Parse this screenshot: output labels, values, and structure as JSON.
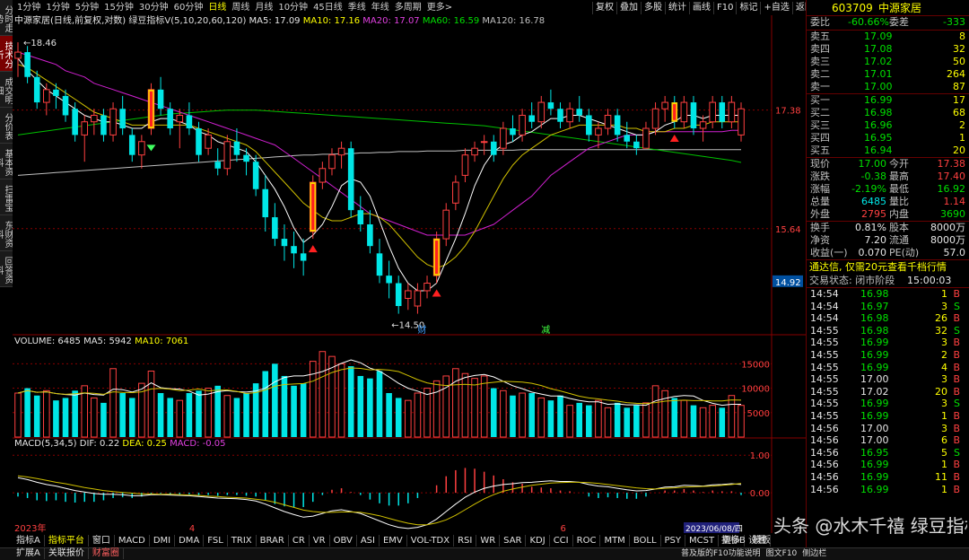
{
  "side_tabs": [
    "分时走势",
    "技术分析",
    "成交明细",
    "分价表",
    "基本资料",
    "扫雷宝",
    "东财资料",
    "回答资料"
  ],
  "period_tabs": [
    "1分钟",
    "1分钟",
    "5分钟",
    "15分钟",
    "30分钟",
    "60分钟",
    "日线",
    "周线",
    "月线",
    "10分钟",
    "45日线",
    "季线",
    "年线",
    "多周期",
    "更多>"
  ],
  "period_active": 6,
  "top_right_buttons": [
    "复权",
    "叠加",
    "多股",
    "统计",
    "画线",
    "F10",
    "标记",
    "+自选",
    "返回"
  ],
  "main": {
    "title": "中源家居(日线,前复权,对数)",
    "indicator": "绿豆指标V(5,10,20,60,120)",
    "ma5": "MA5: 17.09",
    "ma10": "MA10: 17.16",
    "ma20": "MA20: 17.07",
    "ma60": "MA60: 16.59",
    "ma120": "MA120: 16.78",
    "high_label": "18.46",
    "low_label": "14.50",
    "y_ticks": [
      "17.38",
      "15.64"
    ],
    "price_tag": "14.92",
    "event_labels": [
      "财",
      "减"
    ]
  },
  "volume": {
    "label": "VOLUME: 6485",
    "ma5": "MA5: 5942",
    "ma10": "MA10: 7061",
    "y_ticks": [
      "15000",
      "10000",
      "5000"
    ]
  },
  "macd": {
    "label": "MACD(5,34,5)",
    "dif": "DIF: 0.22",
    "dea": "DEA: 0.25",
    "macd": "MACD: -0.05",
    "y_ticks": [
      "1.00",
      "0.00"
    ]
  },
  "x_labels": [
    "2023年",
    "4",
    "6",
    "2023/06/08/四"
  ],
  "chart_data": {
    "type": "candlestick",
    "ylim": [
      14.3,
      18.7
    ],
    "candles": [
      [
        18.2,
        18.46,
        17.9,
        18.3
      ],
      [
        18.3,
        18.4,
        17.8,
        17.9
      ],
      [
        17.9,
        18.0,
        17.4,
        17.5
      ],
      [
        17.5,
        17.8,
        17.3,
        17.7
      ],
      [
        17.7,
        17.8,
        17.4,
        17.6
      ],
      [
        17.6,
        17.7,
        17.2,
        17.3
      ],
      [
        17.4,
        17.5,
        16.9,
        17.0
      ],
      [
        17.0,
        17.3,
        16.6,
        17.2
      ],
      [
        17.2,
        17.4,
        17.0,
        17.3
      ],
      [
        17.3,
        17.4,
        16.9,
        17.0
      ],
      [
        17.0,
        17.5,
        16.9,
        17.4
      ],
      [
        17.4,
        17.6,
        17.0,
        17.1
      ],
      [
        17.0,
        17.1,
        16.6,
        16.7
      ],
      [
        16.7,
        17.0,
        16.5,
        16.9
      ],
      [
        17.1,
        17.8,
        17.0,
        17.7
      ],
      [
        17.7,
        17.9,
        17.3,
        17.4
      ],
      [
        17.4,
        17.5,
        17.0,
        17.1
      ],
      [
        17.2,
        17.4,
        16.8,
        17.3
      ],
      [
        17.3,
        17.5,
        17.0,
        17.1
      ],
      [
        17.1,
        17.2,
        16.6,
        16.7
      ],
      [
        16.8,
        17.1,
        16.7,
        17.0
      ],
      [
        16.6,
        16.8,
        16.4,
        16.5
      ],
      [
        16.5,
        17.0,
        16.4,
        16.9
      ],
      [
        16.9,
        17.1,
        16.6,
        16.7
      ],
      [
        16.7,
        16.8,
        16.4,
        16.6
      ],
      [
        16.6,
        16.7,
        16.1,
        16.2
      ],
      [
        16.2,
        16.4,
        15.6,
        15.8
      ],
      [
        15.8,
        16.0,
        15.4,
        15.5
      ],
      [
        15.5,
        15.7,
        15.2,
        15.4
      ],
      [
        15.4,
        15.6,
        15.1,
        15.3
      ],
      [
        15.3,
        15.5,
        15.0,
        15.2
      ],
      [
        15.6,
        16.4,
        15.5,
        16.3
      ],
      [
        16.3,
        16.6,
        16.2,
        16.5
      ],
      [
        16.5,
        16.8,
        16.4,
        16.7
      ],
      [
        16.7,
        16.9,
        16.5,
        16.8
      ],
      [
        16.8,
        16.9,
        15.8,
        15.9
      ],
      [
        15.9,
        16.1,
        15.6,
        15.7
      ],
      [
        15.7,
        15.9,
        15.3,
        15.4
      ],
      [
        15.3,
        15.5,
        14.9,
        15.0
      ],
      [
        15.0,
        15.2,
        14.7,
        14.9
      ],
      [
        14.9,
        15.0,
        14.5,
        14.6
      ],
      [
        14.7,
        14.9,
        14.55,
        14.8
      ],
      [
        14.6,
        14.9,
        14.5,
        14.8
      ],
      [
        14.8,
        15.0,
        14.7,
        14.9
      ],
      [
        15.0,
        15.6,
        14.9,
        15.5
      ],
      [
        15.5,
        16.0,
        15.4,
        15.9
      ],
      [
        16.0,
        16.4,
        15.9,
        16.3
      ],
      [
        16.4,
        16.8,
        16.3,
        16.7
      ],
      [
        16.7,
        16.9,
        16.6,
        16.8
      ],
      [
        16.9,
        17.0,
        16.7,
        16.9
      ],
      [
        16.9,
        17.0,
        16.6,
        16.7
      ],
      [
        16.8,
        17.2,
        16.7,
        17.1
      ],
      [
        17.1,
        17.3,
        16.9,
        17.0
      ],
      [
        17.0,
        17.4,
        16.9,
        17.3
      ],
      [
        17.3,
        17.5,
        17.1,
        17.2
      ],
      [
        17.2,
        17.6,
        17.1,
        17.5
      ],
      [
        17.5,
        17.7,
        17.3,
        17.4
      ],
      [
        17.4,
        17.5,
        17.1,
        17.2
      ],
      [
        17.2,
        17.5,
        17.1,
        17.4
      ],
      [
        17.4,
        17.6,
        17.2,
        17.3
      ],
      [
        17.3,
        17.4,
        16.9,
        17.0
      ],
      [
        17.0,
        17.2,
        16.8,
        17.1
      ],
      [
        17.1,
        17.4,
        17.0,
        17.3
      ],
      [
        17.3,
        17.4,
        16.9,
        17.0
      ],
      [
        17.0,
        17.2,
        16.8,
        16.9
      ],
      [
        16.9,
        17.0,
        16.7,
        16.8
      ],
      [
        16.8,
        17.2,
        16.8,
        17.1
      ],
      [
        17.1,
        17.5,
        17.0,
        17.4
      ],
      [
        17.4,
        17.6,
        17.2,
        17.5
      ],
      [
        17.5,
        17.6,
        17.1,
        17.2
      ],
      [
        17.2,
        17.6,
        17.1,
        17.5
      ],
      [
        17.5,
        17.6,
        17.0,
        17.1
      ],
      [
        17.1,
        17.3,
        16.9,
        17.2
      ],
      [
        17.2,
        17.6,
        17.1,
        17.5
      ],
      [
        17.5,
        17.6,
        17.1,
        17.2
      ],
      [
        17.2,
        17.6,
        17.1,
        17.5
      ],
      [
        17.0,
        17.5,
        16.9,
        17.4
      ]
    ],
    "ma5": [
      18.2,
      18.0,
      17.85,
      17.7,
      17.6,
      17.5,
      17.4,
      17.3,
      17.25,
      17.2,
      17.2,
      17.15,
      17.1,
      17.1,
      17.2,
      17.25,
      17.25,
      17.2,
      17.15,
      17.05,
      17.0,
      16.9,
      16.85,
      16.8,
      16.75,
      16.6,
      16.4,
      16.2,
      15.95,
      15.65,
      15.45,
      15.55,
      15.7,
      15.95,
      16.25,
      16.35,
      16.3,
      16.1,
      15.75,
      15.4,
      15.1,
      14.9,
      14.8,
      14.8,
      14.9,
      15.2,
      15.5,
      15.85,
      16.25,
      16.55,
      16.75,
      16.85,
      16.9,
      17.0,
      17.05,
      17.15,
      17.25,
      17.25,
      17.3,
      17.3,
      17.25,
      17.2,
      17.15,
      17.1,
      17.05,
      17.0,
      17.0,
      17.05,
      17.15,
      17.2,
      17.3,
      17.3,
      17.25,
      17.3,
      17.3,
      17.3,
      17.3
    ],
    "ma10": [
      18.1,
      18.05,
      17.95,
      17.85,
      17.75,
      17.65,
      17.55,
      17.45,
      17.35,
      17.3,
      17.25,
      17.2,
      17.15,
      17.15,
      17.15,
      17.15,
      17.15,
      17.15,
      17.15,
      17.1,
      17.05,
      17.0,
      16.95,
      16.9,
      16.85,
      16.75,
      16.6,
      16.45,
      16.3,
      16.15,
      16.0,
      15.9,
      15.8,
      15.75,
      15.75,
      15.8,
      15.85,
      15.85,
      15.8,
      15.7,
      15.55,
      15.4,
      15.25,
      15.15,
      15.1,
      15.15,
      15.25,
      15.4,
      15.6,
      15.85,
      16.1,
      16.35,
      16.55,
      16.7,
      16.8,
      16.9,
      17.0,
      17.05,
      17.1,
      17.15,
      17.15,
      17.15,
      17.15,
      17.15,
      17.1,
      17.1,
      17.05,
      17.05,
      17.05,
      17.1,
      17.1,
      17.15,
      17.15,
      17.2,
      17.2,
      17.2,
      17.2
    ],
    "ma20": [
      18.3,
      18.25,
      18.2,
      18.15,
      18.1,
      18.0,
      17.95,
      17.9,
      17.8,
      17.75,
      17.7,
      17.65,
      17.6,
      17.55,
      17.5,
      17.45,
      17.4,
      17.35,
      17.3,
      17.25,
      17.2,
      17.15,
      17.1,
      17.05,
      17.0,
      16.95,
      16.9,
      16.85,
      16.75,
      16.65,
      16.55,
      16.45,
      16.35,
      16.25,
      16.15,
      16.05,
      15.95,
      15.85,
      15.8,
      15.75,
      15.7,
      15.65,
      15.6,
      15.55,
      15.55,
      15.55,
      15.55,
      15.55,
      15.6,
      15.65,
      15.7,
      15.8,
      15.9,
      16.0,
      16.1,
      16.25,
      16.4,
      16.5,
      16.6,
      16.7,
      16.8,
      16.85,
      16.9,
      16.95,
      17.0,
      17.0,
      17.0,
      17.05,
      17.05,
      17.05,
      17.05,
      17.05,
      17.05,
      17.05,
      17.05,
      17.07,
      17.07
    ],
    "ma60": [
      17.0,
      17.02,
      17.04,
      17.06,
      17.08,
      17.1,
      17.12,
      17.14,
      17.16,
      17.18,
      17.2,
      17.22,
      17.24,
      17.26,
      17.28,
      17.3,
      17.32,
      17.33,
      17.34,
      17.35,
      17.36,
      17.37,
      17.38,
      17.38,
      17.38,
      17.38,
      17.37,
      17.36,
      17.35,
      17.34,
      17.33,
      17.32,
      17.31,
      17.3,
      17.29,
      17.28,
      17.27,
      17.26,
      17.25,
      17.24,
      17.23,
      17.22,
      17.21,
      17.2,
      17.19,
      17.18,
      17.17,
      17.16,
      17.15,
      17.14,
      17.12,
      17.1,
      17.08,
      17.06,
      17.04,
      17.02,
      17.0,
      16.98,
      16.96,
      16.94,
      16.92,
      16.9,
      16.88,
      16.86,
      16.84,
      16.82,
      16.8,
      16.78,
      16.76,
      16.74,
      16.72,
      16.7,
      16.68,
      16.66,
      16.64,
      16.62,
      16.59
    ],
    "ma120": [
      16.4,
      16.41,
      16.42,
      16.43,
      16.44,
      16.45,
      16.46,
      16.47,
      16.48,
      16.49,
      16.5,
      16.51,
      16.52,
      16.53,
      16.54,
      16.55,
      16.56,
      16.57,
      16.58,
      16.59,
      16.6,
      16.61,
      16.62,
      16.63,
      16.64,
      16.65,
      16.66,
      16.67,
      16.68,
      16.69,
      16.7,
      16.7,
      16.71,
      16.71,
      16.72,
      16.72,
      16.73,
      16.73,
      16.74,
      16.74,
      16.75,
      16.75,
      16.75,
      16.76,
      16.76,
      16.76,
      16.76,
      16.77,
      16.77,
      16.77,
      16.77,
      16.77,
      16.77,
      16.78,
      16.78,
      16.78,
      16.78,
      16.78,
      16.78,
      16.78,
      16.78,
      16.78,
      16.78,
      16.78,
      16.78,
      16.78,
      16.78,
      16.78,
      16.78,
      16.78,
      16.78,
      16.78,
      16.78,
      16.78,
      16.78,
      16.78,
      16.78
    ],
    "volume": [
      9000,
      10000,
      8500,
      9500,
      7500,
      8000,
      9500,
      10500,
      8000,
      7000,
      14000,
      9000,
      8000,
      11000,
      13500,
      9000,
      8000,
      7500,
      9000,
      9500,
      10000,
      10500,
      8500,
      8000,
      9000,
      11000,
      13500,
      15000,
      12500,
      10500,
      11000,
      15500,
      17500,
      16500,
      15000,
      14500,
      12500,
      12000,
      13500,
      9000,
      8000,
      7500,
      9000,
      10000,
      11500,
      12500,
      14000,
      13000,
      12000,
      12500,
      10000,
      9500,
      8500,
      9000,
      9000,
      8000,
      7500,
      8500,
      6500,
      7000,
      6500,
      7500,
      6000,
      7000,
      6000,
      6500,
      7000,
      10500,
      9500,
      8000,
      7500,
      6500,
      6000,
      6500,
      6000,
      8500,
      6485
    ],
    "volume_ylim": [
      0,
      18000
    ],
    "macd_dif": [
      0.4,
      0.35,
      0.28,
      0.22,
      0.18,
      0.12,
      0.06,
      0.02,
      -0.02,
      -0.04,
      -0.04,
      -0.05,
      -0.08,
      -0.08,
      -0.05,
      -0.05,
      -0.06,
      -0.07,
      -0.08,
      -0.1,
      -0.12,
      -0.14,
      -0.15,
      -0.16,
      -0.18,
      -0.22,
      -0.3,
      -0.4,
      -0.5,
      -0.58,
      -0.65,
      -0.62,
      -0.55,
      -0.48,
      -0.45,
      -0.5,
      -0.55,
      -0.65,
      -0.75,
      -0.85,
      -0.92,
      -0.95,
      -0.92,
      -0.85,
      -0.7,
      -0.5,
      -0.3,
      -0.12,
      0.02,
      0.12,
      0.18,
      0.22,
      0.24,
      0.27,
      0.28,
      0.3,
      0.32,
      0.3,
      0.3,
      0.28,
      0.22,
      0.18,
      0.16,
      0.12,
      0.08,
      0.05,
      0.06,
      0.1,
      0.15,
      0.16,
      0.2,
      0.19,
      0.18,
      0.21,
      0.22,
      0.24,
      0.22
    ],
    "macd_dea": [
      0.45,
      0.42,
      0.38,
      0.33,
      0.28,
      0.24,
      0.19,
      0.14,
      0.1,
      0.06,
      0.03,
      0.01,
      -0.01,
      -0.03,
      -0.03,
      -0.04,
      -0.04,
      -0.05,
      -0.06,
      -0.07,
      -0.09,
      -0.1,
      -0.12,
      -0.13,
      -0.14,
      -0.17,
      -0.2,
      -0.25,
      -0.32,
      -0.39,
      -0.46,
      -0.5,
      -0.52,
      -0.52,
      -0.51,
      -0.51,
      -0.52,
      -0.56,
      -0.61,
      -0.68,
      -0.75,
      -0.81,
      -0.85,
      -0.85,
      -0.8,
      -0.72,
      -0.6,
      -0.45,
      -0.3,
      -0.16,
      -0.05,
      0.04,
      0.1,
      0.15,
      0.2,
      0.23,
      0.26,
      0.27,
      0.28,
      0.28,
      0.27,
      0.25,
      0.22,
      0.19,
      0.16,
      0.13,
      0.11,
      0.1,
      0.12,
      0.13,
      0.15,
      0.16,
      0.17,
      0.18,
      0.2,
      0.22,
      0.25
    ],
    "macd_ylim": [
      -1.0,
      1.1
    ]
  },
  "quote": {
    "code": "603709",
    "name": "中源家居",
    "weibi_label": "委比",
    "weibi": "-60.66%",
    "weicha_label": "委差",
    "weicha": "-333",
    "asks": [
      {
        "label": "卖五",
        "price": "17.09",
        "vol": "8"
      },
      {
        "label": "卖四",
        "price": "17.08",
        "vol": "32"
      },
      {
        "label": "卖三",
        "price": "17.02",
        "vol": "50"
      },
      {
        "label": "卖二",
        "price": "17.01",
        "vol": "264"
      },
      {
        "label": "卖一",
        "price": "17.00",
        "vol": "87"
      }
    ],
    "bids": [
      {
        "label": "买一",
        "price": "16.99",
        "vol": "17"
      },
      {
        "label": "买二",
        "price": "16.98",
        "vol": "68"
      },
      {
        "label": "买三",
        "price": "16.96",
        "vol": "2"
      },
      {
        "label": "买四",
        "price": "16.95",
        "vol": "1"
      },
      {
        "label": "买五",
        "price": "16.94",
        "vol": "20"
      }
    ],
    "stats": [
      {
        "l1": "现价",
        "v1": "17.00",
        "c1": "green",
        "l2": "今开",
        "v2": "17.38",
        "c2": "red"
      },
      {
        "l1": "涨跌",
        "v1": "-0.38",
        "c1": "green",
        "l2": "最高",
        "v2": "17.40",
        "c2": "red"
      },
      {
        "l1": "涨幅",
        "v1": "-2.19%",
        "c1": "green",
        "l2": "最低",
        "v2": "16.92",
        "c2": "green"
      },
      {
        "l1": "总量",
        "v1": "6485",
        "c1": "cyan",
        "l2": "量比",
        "v2": "1.14",
        "c2": "red"
      },
      {
        "l1": "外盘",
        "v1": "2795",
        "c1": "red",
        "l2": "内盘",
        "v2": "3690",
        "c2": "green"
      }
    ],
    "stats2": [
      {
        "l1": "换手",
        "v1": "0.81%",
        "l2": "股本",
        "v2": "8000万"
      },
      {
        "l1": "净资",
        "v1": "7.20",
        "l2": "流通",
        "v2": "8000万"
      },
      {
        "l1": "收益(一)",
        "v1": "0.070",
        "l2": "PE(动)",
        "v2": "57.0"
      }
    ],
    "notice": "通达信, 仅需20元查看千档行情",
    "status_label": "交易状态: 闭市阶段",
    "status_time": "15:00:03",
    "ticks": [
      {
        "t": "14:54",
        "p": "16.98",
        "v": "1",
        "d": "B"
      },
      {
        "t": "14:54",
        "p": "16.97",
        "v": "3",
        "d": "S"
      },
      {
        "t": "14:54",
        "p": "16.98",
        "v": "26",
        "d": "B"
      },
      {
        "t": "14:55",
        "p": "16.98",
        "v": "32",
        "d": "S"
      },
      {
        "t": "14:55",
        "p": "16.99",
        "v": "3",
        "d": "B"
      },
      {
        "t": "14:55",
        "p": "16.99",
        "v": "2",
        "d": "B"
      },
      {
        "t": "14:55",
        "p": "16.99",
        "v": "4",
        "d": "B"
      },
      {
        "t": "14:55",
        "p": "17.00",
        "v": "3",
        "d": "B"
      },
      {
        "t": "14:55",
        "p": "17.02",
        "v": "20",
        "d": "B"
      },
      {
        "t": "14:55",
        "p": "16.99",
        "v": "3",
        "d": "S"
      },
      {
        "t": "14:55",
        "p": "16.99",
        "v": "1",
        "d": "B"
      },
      {
        "t": "14:56",
        "p": "17.00",
        "v": "3",
        "d": "B"
      },
      {
        "t": "14:56",
        "p": "17.00",
        "v": "6",
        "d": "B"
      },
      {
        "t": "14:56",
        "p": "16.95",
        "v": "5",
        "d": "S"
      },
      {
        "t": "14:56",
        "p": "16.99",
        "v": "1",
        "d": "B"
      },
      {
        "t": "14:56",
        "p": "16.99",
        "v": "11",
        "d": "B"
      },
      {
        "t": "14:56",
        "p": "16.99",
        "v": "1",
        "d": "B"
      }
    ]
  },
  "bottom_tabs": [
    "指标A",
    "指标平台",
    "窗口",
    "MACD",
    "DMI",
    "DMA",
    "FSL",
    "TRIX",
    "BRAR",
    "CR",
    "VR",
    "OBV",
    "ASI",
    "EMV",
    "VOL-TDX",
    "RSI",
    "WR",
    "SAR",
    "KDJ",
    "CCI",
    "ROC",
    "MTM",
    "BOLL",
    "PSY",
    "MCST",
    "更多",
    "设置"
  ],
  "bottom_tabs_active": 1,
  "bottom_right": [
    "指标B",
    "模板"
  ],
  "status_bar": [
    "扩展A",
    "关联报价",
    "财富圈"
  ],
  "status_bar_right": [
    "普及版的F10功能说明",
    "图文F10",
    "侧边栏"
  ],
  "watermark": "头条 @水木千禧 绿豆指标"
}
